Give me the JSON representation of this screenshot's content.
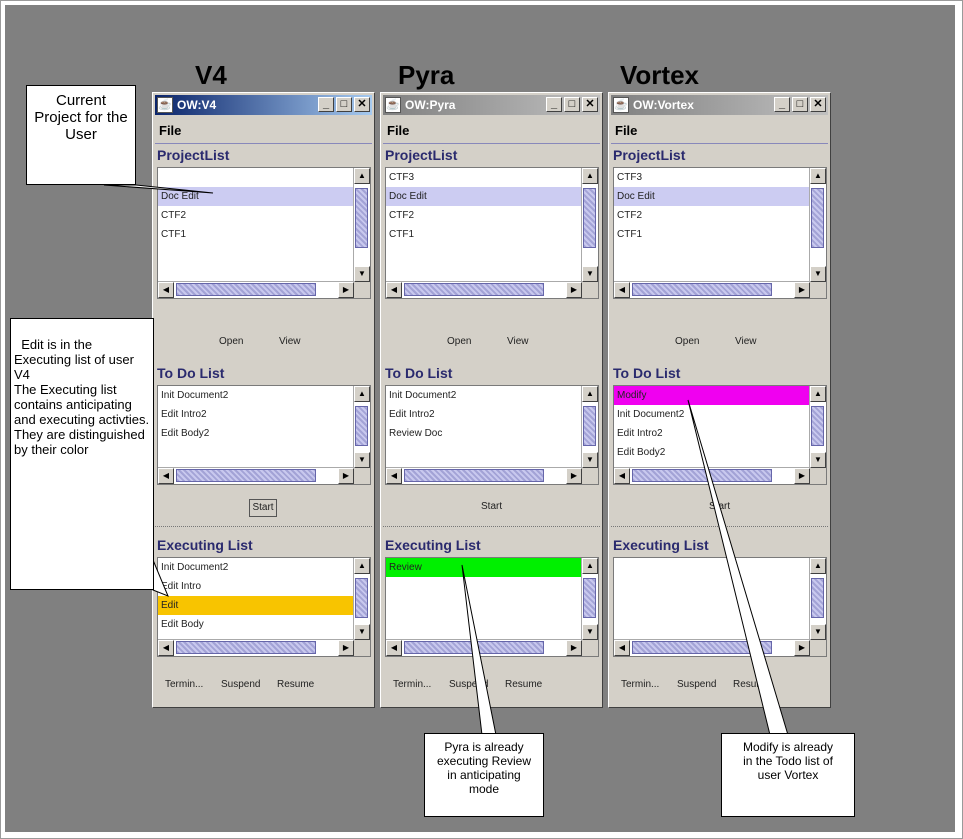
{
  "windows": [
    {
      "heading": "V4",
      "title": "OW:V4",
      "active": true,
      "menu": "File",
      "project_list_label": "ProjectList",
      "projects": [
        {
          "text": "",
          "color": ""
        },
        {
          "text": "Doc Edit",
          "color": "blue"
        },
        {
          "text": "CTF2",
          "color": ""
        },
        {
          "text": "CTF1",
          "color": ""
        }
      ],
      "open_label": "Open",
      "view_label": "View",
      "todo_label": "To Do List",
      "todo_items": [
        {
          "text": "Init Document2",
          "color": ""
        },
        {
          "text": "Edit Intro2",
          "color": ""
        },
        {
          "text": "Edit Body2",
          "color": ""
        }
      ],
      "start_label": "Start",
      "start_boxed": true,
      "executing_label": "Executing List",
      "executing_items": [
        {
          "text": "Init Document2",
          "color": ""
        },
        {
          "text": "Edit Intro",
          "color": ""
        },
        {
          "text": "Edit",
          "color": "orange"
        },
        {
          "text": "Edit Body",
          "color": ""
        }
      ],
      "bottom_buttons": [
        "Termin...",
        "Suspend",
        "Resume"
      ]
    },
    {
      "heading": "Pyra",
      "title": "OW:Pyra",
      "active": false,
      "menu": "File",
      "project_list_label": "ProjectList",
      "projects": [
        {
          "text": "CTF3",
          "color": ""
        },
        {
          "text": "Doc Edit",
          "color": "blue"
        },
        {
          "text": "CTF2",
          "color": ""
        },
        {
          "text": "CTF1",
          "color": ""
        }
      ],
      "open_label": "Open",
      "view_label": "View",
      "todo_label": "To Do List",
      "todo_items": [
        {
          "text": "Init Document2",
          "color": ""
        },
        {
          "text": "Edit Intro2",
          "color": ""
        },
        {
          "text": "Review Doc",
          "color": ""
        }
      ],
      "start_label": "Start",
      "start_boxed": false,
      "executing_label": "Executing List",
      "executing_items": [
        {
          "text": "Review",
          "color": "green"
        }
      ],
      "bottom_buttons": [
        "Termin...",
        "Suspend",
        "Resume"
      ]
    },
    {
      "heading": "Vortex",
      "title": "OW:Vortex",
      "active": false,
      "menu": "File",
      "project_list_label": "ProjectList",
      "projects": [
        {
          "text": "CTF3",
          "color": ""
        },
        {
          "text": "Doc Edit",
          "color": "blue"
        },
        {
          "text": "CTF2",
          "color": ""
        },
        {
          "text": "CTF1",
          "color": ""
        }
      ],
      "open_label": "Open",
      "view_label": "View",
      "todo_label": "To Do List",
      "todo_items": [
        {
          "text": "Modify",
          "color": "magenta"
        },
        {
          "text": "Init Document2",
          "color": ""
        },
        {
          "text": "Edit Intro2",
          "color": ""
        },
        {
          "text": "Edit Body2",
          "color": ""
        }
      ],
      "start_label": "Start",
      "start_boxed": false,
      "executing_label": "Executing List",
      "executing_items": [],
      "bottom_buttons": [
        "Termin...",
        "Suspend",
        "Resume"
      ]
    }
  ],
  "callouts": {
    "current_project": "Current Project for the User",
    "edit_executing": "Edit is in the Executing list of user V4\nThe Executing list contains anticipating and executing activties. They are distinguished by their color",
    "pyra_review": "Pyra is already executing Review in anticipating mode",
    "modify_todo": "Modify is already in the Todo list of user Vortex"
  },
  "colors": {
    "background": "#808080",
    "window": "#d4d0c8",
    "selected_project": "#ccccf2",
    "executing_orange": "#f8c400",
    "anticipating_green": "#00f000",
    "todo_magenta": "#f000f0"
  }
}
